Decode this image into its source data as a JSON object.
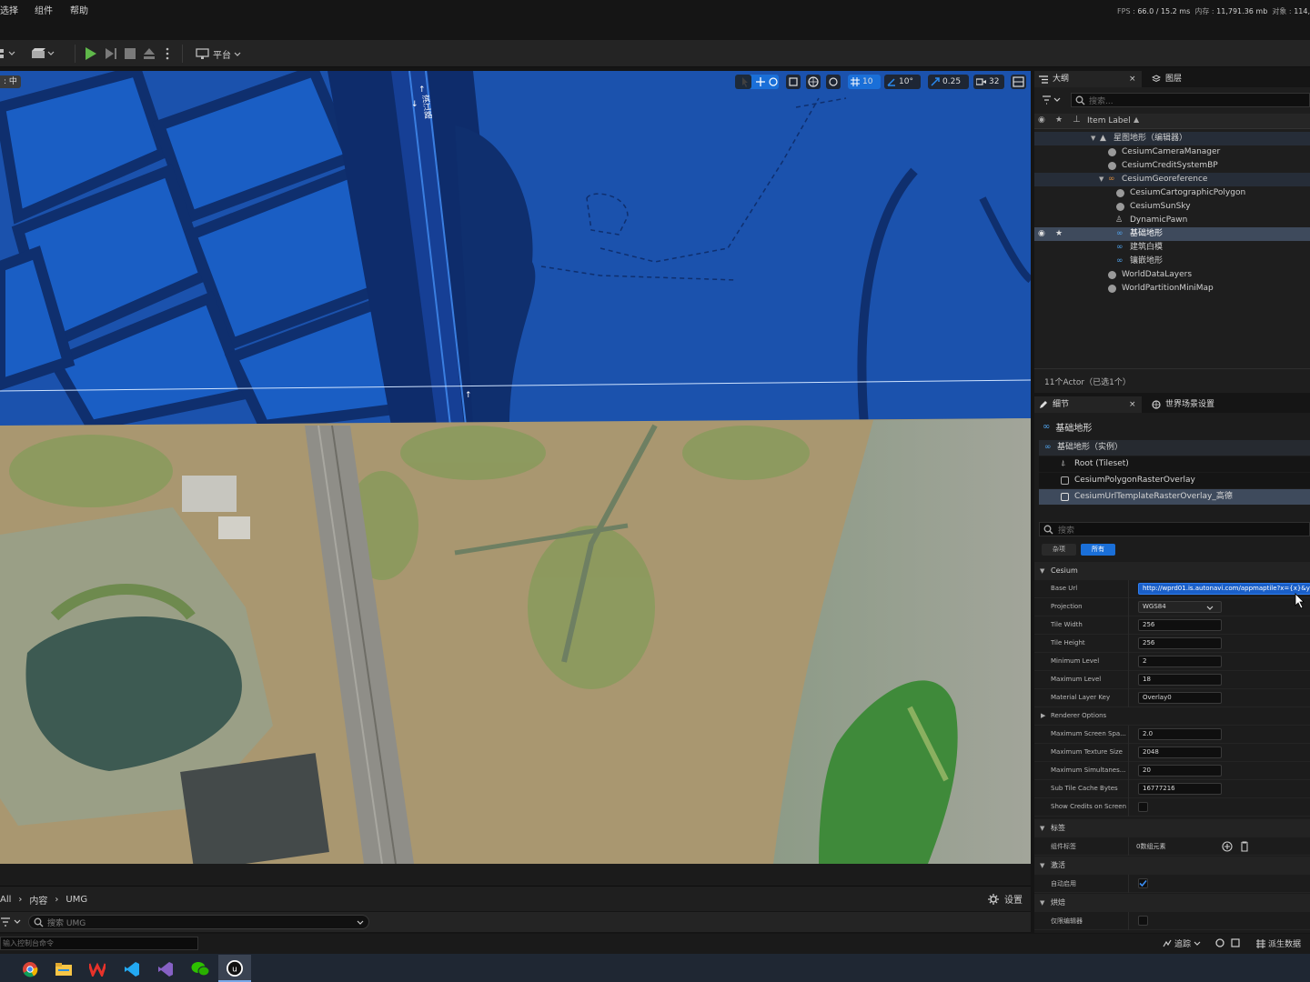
{
  "menu": {
    "items": [
      "选择",
      "组件",
      "帮助"
    ]
  },
  "stats": {
    "fps_label": "FPS :",
    "fps": "66.0",
    "frame_time": "/ 15.2 ms",
    "mem_label": "内存 :",
    "mem": "11,791.36 mb",
    "obj_label": "对象 :",
    "obj": "114,"
  },
  "toolbar": {
    "platform_label": "平台"
  },
  "viewport": {
    "mode_label": ": 中",
    "road_label": "滨江路",
    "grid_value": "10",
    "rotate_value": "10°",
    "scale_value": "0.25",
    "camera_speed": "32"
  },
  "outliner": {
    "tab_label": "大纲",
    "layers_tab_label": "图层",
    "search_placeholder": "搜索...",
    "column_label": "Item Label",
    "rows": [
      "星图地形（编辑器）",
      "CesiumCameraManager",
      "CesiumCreditSystemBP",
      "CesiumGeoreference",
      "CesiumCartographicPolygon",
      "CesiumSunSky",
      "DynamicPawn",
      "基础地形",
      "建筑白模",
      "镶嵌地形",
      "WorldDataLayers",
      "WorldPartitionMiniMap"
    ],
    "actor_count": "11个Actor（已选1个）"
  },
  "details": {
    "tab_label": "细节",
    "world_settings_label": "世界场景设置",
    "object_name": "基础地形",
    "components": [
      "基础地形（实例）",
      "Root (Tileset)",
      "CesiumPolygonRasterOverlay",
      "CesiumUrlTemplateRasterOverlay_高德"
    ],
    "search_placeholder": "搜索",
    "filter_general": "杂项",
    "filter_all": "所有",
    "section_cesium": "Cesium",
    "props": [
      {
        "label": "Base Url",
        "value": "http://wprd01.is.autonavi.com/appmaptile?x={x}&y"
      },
      {
        "label": "Projection",
        "value": "WGS84"
      },
      {
        "label": "Tile Width",
        "value": "256"
      },
      {
        "label": "Tile Height",
        "value": "256"
      },
      {
        "label": "Minimum Level",
        "value": "2"
      },
      {
        "label": "Maximum Level",
        "value": "18"
      },
      {
        "label": "Material Layer Key",
        "value": "Overlay0"
      }
    ],
    "renderer_options_label": "Renderer Options",
    "props2": [
      {
        "label": "Maximum Screen Spa...",
        "value": "2.0"
      },
      {
        "label": "Maximum Texture Size",
        "value": "2048"
      },
      {
        "label": "Maximum Simultanes...",
        "value": "20"
      },
      {
        "label": "Sub Tile Cache Bytes",
        "value": "16777216"
      }
    ],
    "show_credits_label": "Show Credits on Screen",
    "section_tags": "标签",
    "component_tags_label": "组件标签",
    "component_tags_value": "0数组元素",
    "section_activation": "激活",
    "auto_activate_label": "自动启用",
    "section_cooking": "烘焙",
    "editor_only_label": "仅限编辑器"
  },
  "content_browser": {
    "breadcrumb": [
      "All",
      "内容",
      "UMG"
    ],
    "settings_label": "设置",
    "search_placeholder": "搜索 UMG"
  },
  "command": {
    "placeholder": "输入控制台命令"
  },
  "status": {
    "trace_label": "追踪",
    "derived_data_label": "派生数据"
  }
}
